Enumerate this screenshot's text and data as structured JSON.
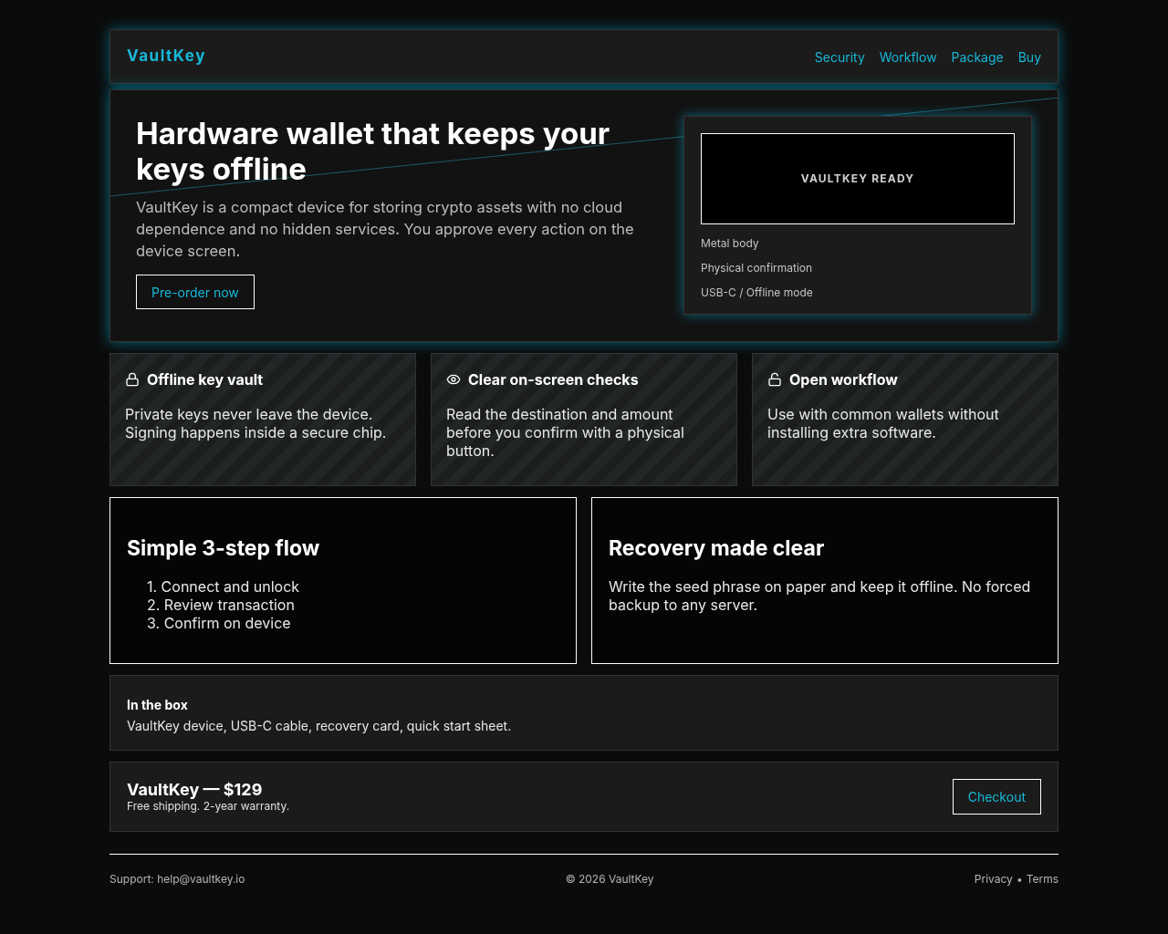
{
  "nav": {
    "brand": "VaultKey",
    "links": [
      "Security",
      "Workflow",
      "Package",
      "Buy"
    ]
  },
  "hero": {
    "title": "Hardware wallet that keeps your keys offline",
    "text": "VaultKey is a compact device for storing crypto assets with no cloud dependence and no hidden services. You approve every action on the device screen.",
    "button": "Pre-order now",
    "device": {
      "screen": "VAULTKEY READY",
      "specs": [
        "Metal body",
        "Physical confirmation",
        "USB-C / Offline mode"
      ]
    }
  },
  "features": [
    {
      "kind": "lock",
      "title": "Offline key vault",
      "text": "Private keys never leave the device. Signing happens inside a secure chip."
    },
    {
      "kind": "eye",
      "title": "Clear on-screen checks",
      "text": "Read the destination and amount before you confirm with a physical button."
    },
    {
      "kind": "unlock",
      "title": "Open workflow",
      "text": "Use with common wallets without installing extra software."
    }
  ],
  "flow": {
    "title": "Simple 3-step flow",
    "steps": [
      "1. Connect and unlock",
      "2. Review transaction",
      "3. Confirm on device"
    ]
  },
  "recovery": {
    "title": "Recovery made clear",
    "text": "Write the seed phrase on paper and keep it offline. No forced backup to any server."
  },
  "box": {
    "title": "In the box",
    "text": "VaultKey device, USB-C cable, recovery card, quick start sheet."
  },
  "price": {
    "title": "VaultKey — $129",
    "subtitle": "Free shipping. 2-year warranty.",
    "button": "Checkout"
  },
  "footer": {
    "support": "Support: help@vaultkey.io",
    "copyright": "© 2026 VaultKey",
    "links": [
      "Privacy",
      "Terms"
    ],
    "separator": "•"
  }
}
